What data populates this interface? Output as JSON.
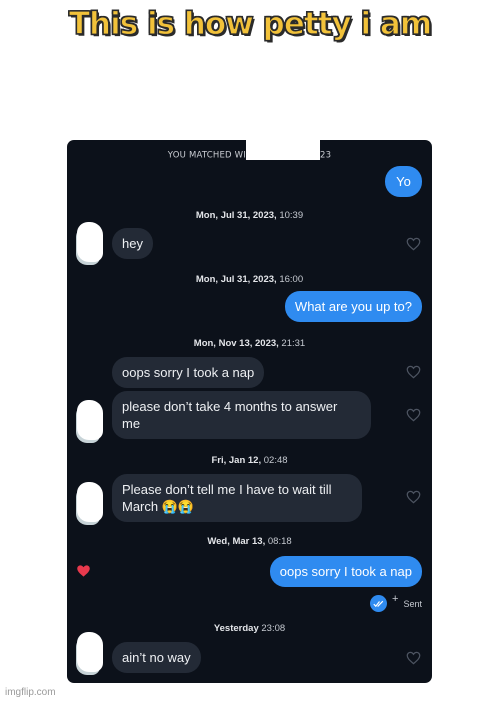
{
  "meme": {
    "caption": "This is how petty i am",
    "watermark": "imgflip.com"
  },
  "chat": {
    "matched_prefix": "YOU MATCHED WI",
    "matched_suffix": "23",
    "sent_status": "Sent",
    "colors": {
      "background": "#0c111a",
      "outgoing_bubble": "#2f8bf0",
      "incoming_bubble": "#232a36",
      "liked_heart": "#e8394d"
    },
    "timestamps": [
      {
        "date": "Mon, Jul 31, 2023,",
        "time": " 10:39"
      },
      {
        "date": "Mon, Jul 31, 2023,",
        "time": " 16:00"
      },
      {
        "date": "Mon, Nov 13, 2023,",
        "time": " 21:31"
      },
      {
        "date": "Fri, Jan 12,",
        "time": " 02:48"
      },
      {
        "date": "Wed, Mar 13,",
        "time": " 08:18"
      },
      {
        "date": "Yesterday",
        "time": " 23:08"
      }
    ],
    "messages": [
      {
        "direction": "outgoing",
        "text": "Yo"
      },
      {
        "direction": "incoming",
        "text": "hey",
        "liked": false
      },
      {
        "direction": "outgoing",
        "text": "What are you up to?"
      },
      {
        "direction": "incoming",
        "text": "oops sorry I took a nap",
        "liked": false
      },
      {
        "direction": "incoming",
        "text": "please don’t take 4 months to answer\nme",
        "liked": false
      },
      {
        "direction": "incoming",
        "text": "Please don’t tell me I have to wait till\nMarch 😭😭",
        "liked": false
      },
      {
        "direction": "outgoing",
        "text": "oops sorry I took a nap",
        "liked": true
      },
      {
        "direction": "incoming",
        "text": "ain’t no way",
        "liked": false
      }
    ]
  }
}
